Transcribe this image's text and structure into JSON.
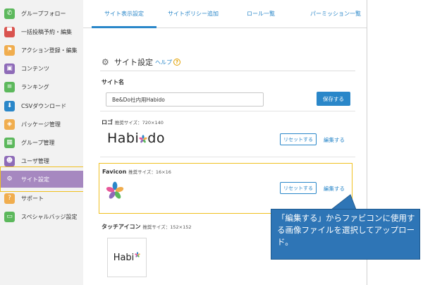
{
  "sidebar": {
    "items": [
      {
        "label": "グループフォロー",
        "icon": "phone-icon",
        "color": "#5cb85c"
      },
      {
        "label": "一括投稿予約・編集",
        "icon": "comment-icon",
        "color": "#d9534f"
      },
      {
        "label": "アクション登録・編集",
        "icon": "flag-icon",
        "color": "#f0ad4e"
      },
      {
        "label": "コンテンツ",
        "icon": "book-icon",
        "color": "#8e6bb8"
      },
      {
        "label": "ランキング",
        "icon": "list-icon",
        "color": "#5cb85c"
      },
      {
        "label": "CSVダウンロード",
        "icon": "download-icon",
        "color": "#2a87c9"
      },
      {
        "label": "パッケージ管理",
        "icon": "layers-icon",
        "color": "#f0ad4e"
      },
      {
        "label": "グループ管理",
        "icon": "grid-icon",
        "color": "#5cb85c"
      },
      {
        "label": "ユーザ管理",
        "icon": "users-icon",
        "color": "#8e6bb8"
      },
      {
        "label": "サイト設定",
        "icon": "gear-icon",
        "color": "#a688c0",
        "active": true
      },
      {
        "label": "サポート",
        "icon": "help-icon",
        "color": "#f0ad4e"
      },
      {
        "label": "スペシャルバッジ設定",
        "icon": "monitor-icon",
        "color": "#5cb85c"
      }
    ]
  },
  "tabs": [
    {
      "label": "サイト表示設定",
      "active": true
    },
    {
      "label": "サイトポリシー追加"
    },
    {
      "label": "ロール一覧"
    },
    {
      "label": "パーミッション一覧"
    }
  ],
  "setting": {
    "title": "サイト設定",
    "help": "ヘルプ",
    "help_icon": "?"
  },
  "site_name": {
    "label": "サイト名",
    "value": "Be&Do社内用Habido",
    "save": "保存する"
  },
  "logo": {
    "label": "ロゴ",
    "hint": "推奨サイズ：720×140",
    "text_left": "Habi",
    "text_right": "do",
    "reset": "リセットする",
    "edit": "編集する"
  },
  "favicon": {
    "label": "Favicon",
    "hint": "推奨サイズ：16×16",
    "reset": "リセットする",
    "edit": "編集する"
  },
  "touch_icon": {
    "label": "タッチアイコン",
    "hint": "推奨サイズ：152×152",
    "text": "Habi"
  },
  "callout": {
    "text": "「編集する」からファビコンに使用する画像ファイルを選択してアップロード。"
  },
  "colors": {
    "accent": "#2a87c9",
    "highlight": "#f0c020",
    "active_nav": "#a688c0",
    "callout": "#2e75b6"
  }
}
